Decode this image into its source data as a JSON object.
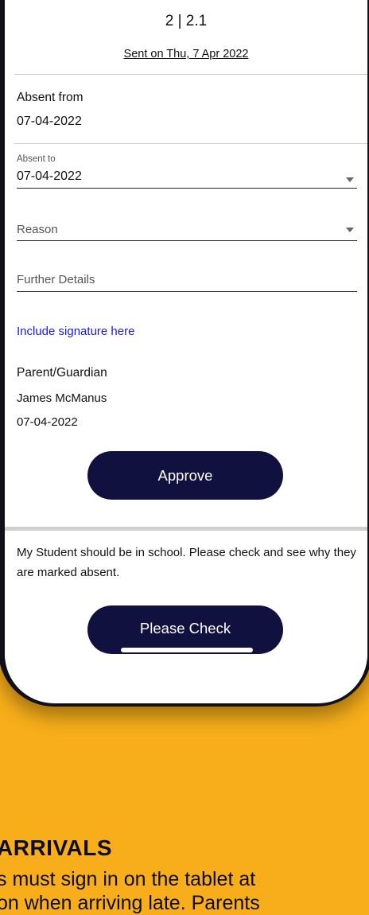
{
  "header": {
    "class_code": "2 | 2.1",
    "sent_on": "Sent on Thu, 7 Apr 2022"
  },
  "form": {
    "absent_from_label": "Absent from",
    "absent_from_value": "07-04-2022",
    "absent_to_label": "Absent to",
    "absent_to_value": "07-04-2022",
    "reason_placeholder": "Reason",
    "further_details_placeholder": "Further Details",
    "signature_link": "Include signature here",
    "guardian_label": "Parent/Guardian",
    "guardian_name": "James McManus",
    "guardian_date": "07-04-2022",
    "approve_button": "Approve"
  },
  "message": {
    "text": "My Student should be in school. Please check and see why they are marked absent.",
    "check_button": "Please Check"
  },
  "background_text": {
    "heading": "ARRIVALS",
    "line1": "s must sign in on the tablet at",
    "line2": "on when arriving late. Parents"
  },
  "colors": {
    "background": "#F7AE1A",
    "button": "#11113f",
    "link": "#1a1ae6"
  }
}
